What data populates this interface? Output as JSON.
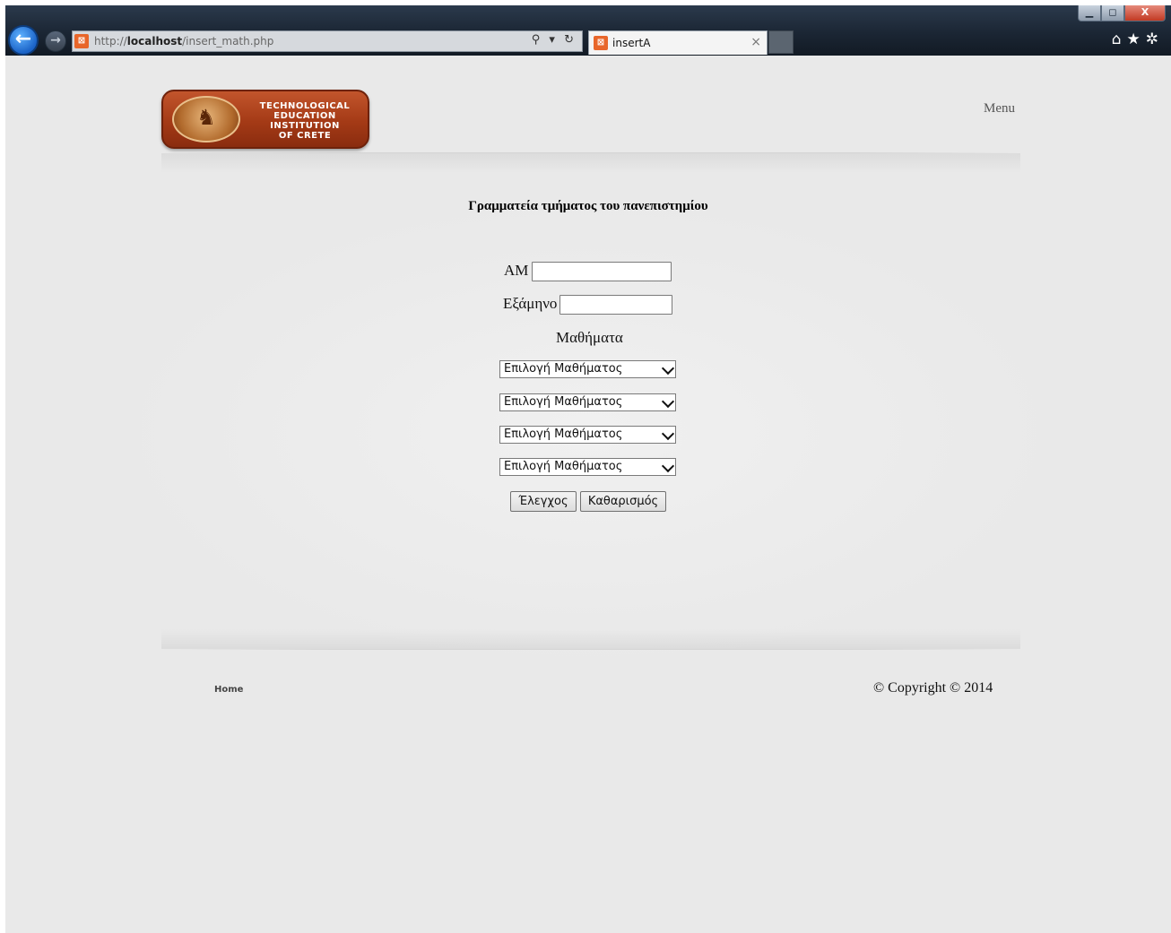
{
  "browser": {
    "url_prefix": "http://",
    "url_host": "localhost",
    "url_path": "/insert_math.php",
    "tab_title": "insertA",
    "addr_icons": "⚲ ▾ ↻",
    "window_controls": {
      "minimize": "▁",
      "restore": "◻",
      "close": "X"
    },
    "icons": [
      "back-arrow-icon",
      "forward-arrow-icon",
      "favicon-icon",
      "search-icon",
      "refresh-icon",
      "close-icon",
      "home-icon",
      "star-icon",
      "gear-icon"
    ]
  },
  "header": {
    "logo_text": "TECHNOLOGICAL\nEDUCATION\nINSTITUTION\nOF CRETE",
    "menu_label": "Menu"
  },
  "main": {
    "heading": "Γραμματεία τμήματος του πανεπιστημίου",
    "am_label": "ΑΜ",
    "am_value": "",
    "semester_label": "Εξάμηνο",
    "semester_value": "",
    "courses_label": "Μαθήματα",
    "course_selects": [
      "Επιλογή Μαθήματος",
      "Επιλογή Μαθήματος",
      "Επιλογή Μαθήματος",
      "Επιλογή Μαθήματος"
    ],
    "check_button": "Έλεγχος",
    "clear_button": "Καθαρισμός"
  },
  "footer": {
    "home_link": "Home",
    "copyright": "© Copyright © 2014"
  }
}
